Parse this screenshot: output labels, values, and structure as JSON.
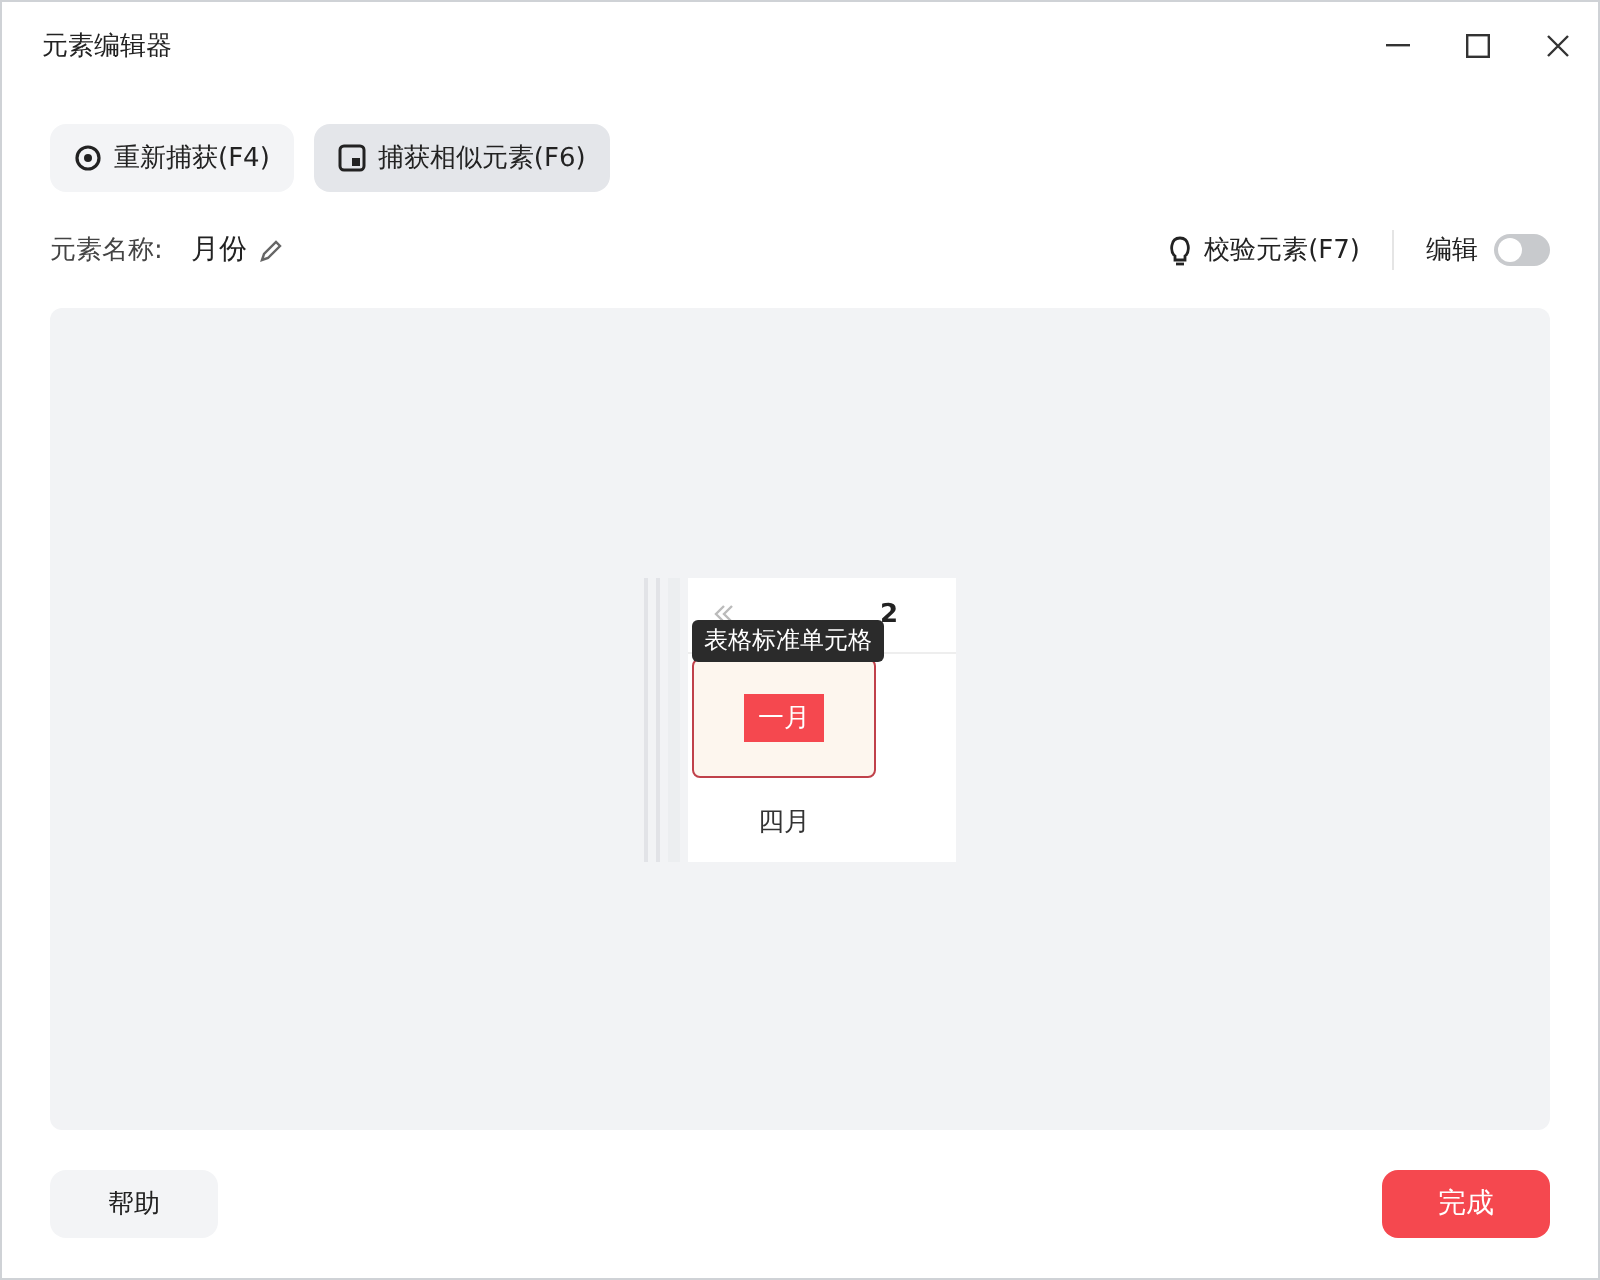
{
  "window": {
    "title": "元素编辑器"
  },
  "toolbar": [
    {
      "label": "重新捕获(F4)",
      "kind": "recapture",
      "selected": false
    },
    {
      "label": "捕获相似元素(F6)",
      "kind": "similar",
      "selected": true
    }
  ],
  "element_name": {
    "label": "元素名称:",
    "value": "月份"
  },
  "validate_button": {
    "label": "校验元素(F7)"
  },
  "edit_toggle": {
    "label": "编辑",
    "on": false
  },
  "preview": {
    "year": "2",
    "tooltip": "表格标准单元格",
    "cells": [
      {
        "label": "一月",
        "selected": true
      },
      {
        "label": "四月",
        "selected": false
      }
    ]
  },
  "footer": {
    "help": "帮助",
    "done": "完成"
  }
}
